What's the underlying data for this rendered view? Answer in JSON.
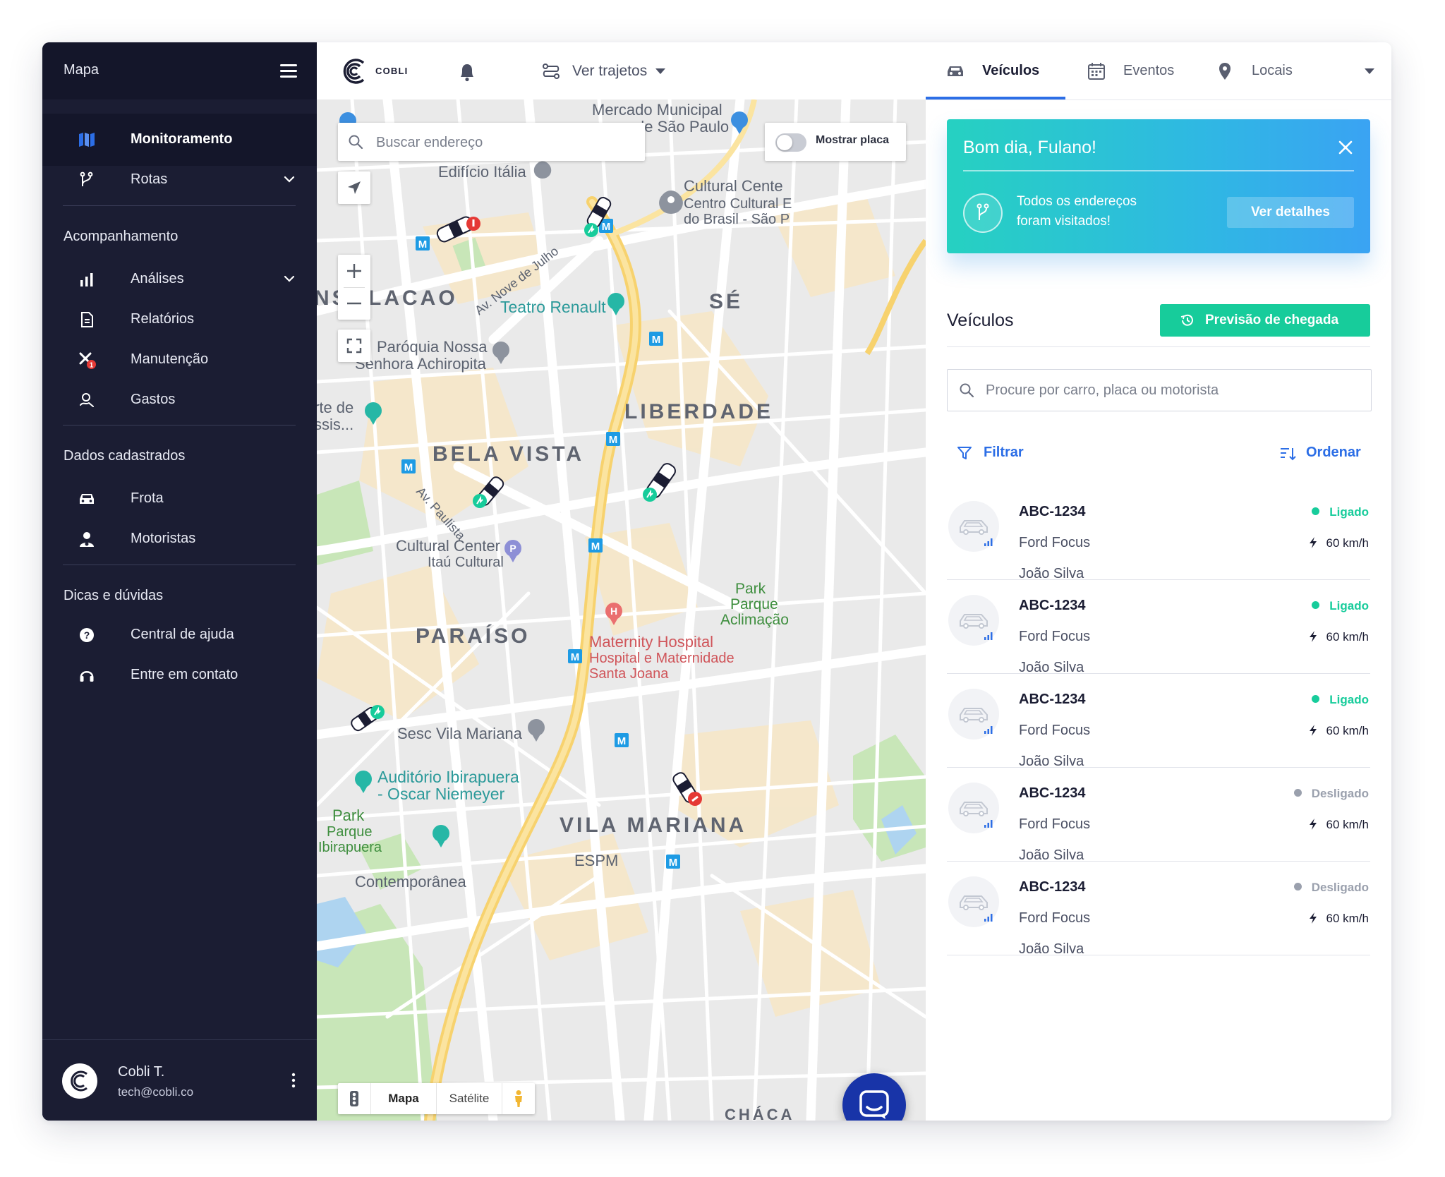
{
  "sidebar": {
    "title": "Mapa",
    "items_main": [
      {
        "label": "Monitoramento",
        "icon": "map-icon",
        "active": true
      },
      {
        "label": "Rotas",
        "icon": "route-icon",
        "expandable": true
      }
    ],
    "sections": [
      {
        "title": "Acompanhamento",
        "items": [
          {
            "label": "Análises",
            "icon": "bar-chart-icon",
            "expandable": true
          },
          {
            "label": "Relatórios",
            "icon": "document-icon"
          },
          {
            "label": "Manutenção",
            "icon": "tools-icon",
            "badge": "1"
          },
          {
            "label": "Gastos",
            "icon": "money-icon"
          }
        ]
      },
      {
        "title": "Dados cadastrados",
        "items": [
          {
            "label": "Frota",
            "icon": "car-icon"
          },
          {
            "label": "Motoristas",
            "icon": "driver-icon"
          }
        ]
      },
      {
        "title": "Dicas e dúvidas",
        "items": [
          {
            "label": "Central de ajuda",
            "icon": "help-icon"
          },
          {
            "label": "Entre em contato",
            "icon": "headset-icon"
          }
        ]
      }
    ],
    "user": {
      "name": "Cobli T.",
      "email": "tech@cobli.co"
    }
  },
  "topbar": {
    "logo_text": "COBLI",
    "trips_label": "Ver trajetos"
  },
  "map": {
    "search_placeholder": "Buscar endereço",
    "plate_toggle_label": "Mostrar placa",
    "plate_toggle_on": false,
    "map_types": [
      "Mapa",
      "Satélite"
    ],
    "selected_map_type": "Mapa",
    "labels": {
      "consolacao": "NSOLACAO",
      "se": "SÉ",
      "liberdade": "LIBERDADE",
      "bela_vista": "BELA VISTA",
      "paraiso": "PARAÍSO",
      "vila_mariana": "VILA MARIANA",
      "edificio_italia": "Edifício Itália",
      "cultural_center_1": "Cultural Cente",
      "cultural_center_2": "Centro Cultural E",
      "cultural_center_3": "do Brasil - São P",
      "mercado_1": "Mercado Municipal",
      "mercado_2": "de São Paulo",
      "av_nove_julho": "Av. Nove de Julho",
      "teatro_renault": "Teatro Renault",
      "paroquia_1": "Paróquia Nossa",
      "paroquia_2": "Senhora Achiropita",
      "arte_1": "rte de",
      "arte_2": "ssis...",
      "av_paulista": "Av. Paulista",
      "itau_1": "Cultural Center",
      "itau_2": "Itaú Cultural",
      "park_aclimacao_1": "Park",
      "park_aclimacao_2": "Parque",
      "park_aclimacao_3": "Aclimação",
      "maternity_1": "Maternity Hospital",
      "maternity_2": "Hospital e Maternidade",
      "maternity_3": "Santa Joana",
      "sesc": "Sesc Vila Mariana",
      "auditorio_1": "Auditório Ibirapuera",
      "auditorio_2": "- Oscar Niemeyer",
      "ibira_1": "Park",
      "ibira_2": "Parque",
      "ibira_3": "Ibirapuera",
      "espm": "ESPM",
      "contemporanea": "Contemporânea",
      "chaca": "CHÁCA",
      "metro": "M",
      "hospital": "H",
      "parking": "P"
    }
  },
  "right": {
    "tabs": [
      {
        "label": "Veículos",
        "icon": "car-icon",
        "active": true
      },
      {
        "label": "Eventos",
        "icon": "calendar-icon"
      },
      {
        "label": "Locais",
        "icon": "pin-icon"
      }
    ],
    "greeting": {
      "title": "Bom dia, Fulano!",
      "message_line1": "Todos os endereços",
      "message_line2": "foram visitados!",
      "button": "Ver detalhes"
    },
    "vehicles_title": "Veículos",
    "eta_button": "Previsão de chegada",
    "search_placeholder": "Procure por carro, placa ou motorista",
    "filter_label": "Filtrar",
    "order_label": "Ordenar",
    "vehicles": [
      {
        "plate": "ABC-1234",
        "model": "Ford Focus",
        "driver": "João Silva",
        "status": "Ligado",
        "speed": "60 km/h"
      },
      {
        "plate": "ABC-1234",
        "model": "Ford Focus",
        "driver": "João Silva",
        "status": "Ligado",
        "speed": "60 km/h"
      },
      {
        "plate": "ABC-1234",
        "model": "Ford Focus",
        "driver": "João Silva",
        "status": "Ligado",
        "speed": "60 km/h"
      },
      {
        "plate": "ABC-1234",
        "model": "Ford Focus",
        "driver": "João Silva",
        "status": "Desligado",
        "speed": "60 km/h"
      },
      {
        "plate": "ABC-1234",
        "model": "Ford Focus",
        "driver": "João Silva",
        "status": "Desligado",
        "speed": "60 km/h"
      }
    ]
  },
  "colors": {
    "sidebar_bg": "#1b1d33",
    "accent_blue": "#2c6ee6",
    "on_green": "#17cc9b",
    "off_gray": "#9aa0ad",
    "alert_red": "#e53935"
  }
}
